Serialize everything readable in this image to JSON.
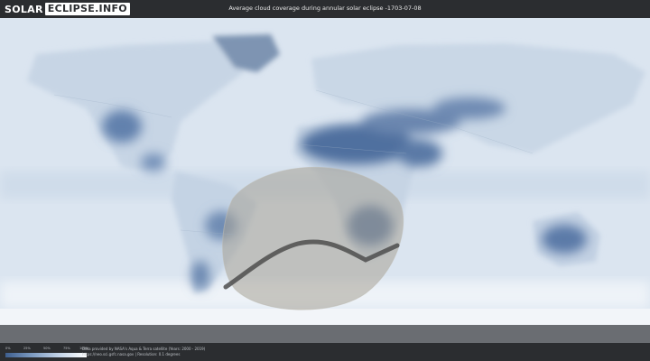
{
  "header": {
    "logo_left": "SOLAR",
    "logo_right": "ECLIPSE.INFO",
    "title": "Average cloud coverage during annular solar eclipse -1703-07-08"
  },
  "legend": {
    "ticks": [
      "0%",
      "25%",
      "50%",
      "75%",
      "100%"
    ],
    "colors": [
      "#3e5f8f",
      "#7e9cc2",
      "#c4d4e8",
      "#ffffff"
    ]
  },
  "footer": {
    "credit_line1": "Data provided by NASA's Aqua & Terra satellite (Years: 2000 - 2019)",
    "credit_line2": "https://neo.sci.gsfc.nasa.gov | Resolution: 0.1 degrees"
  },
  "colors": {
    "background": "#2b2d30",
    "ocean_cloud": "#dde7f1",
    "clear_sky": "#4e6f9e",
    "eclipse_path": "#4d4d4d",
    "shadow_zone": "#a8a49c"
  }
}
